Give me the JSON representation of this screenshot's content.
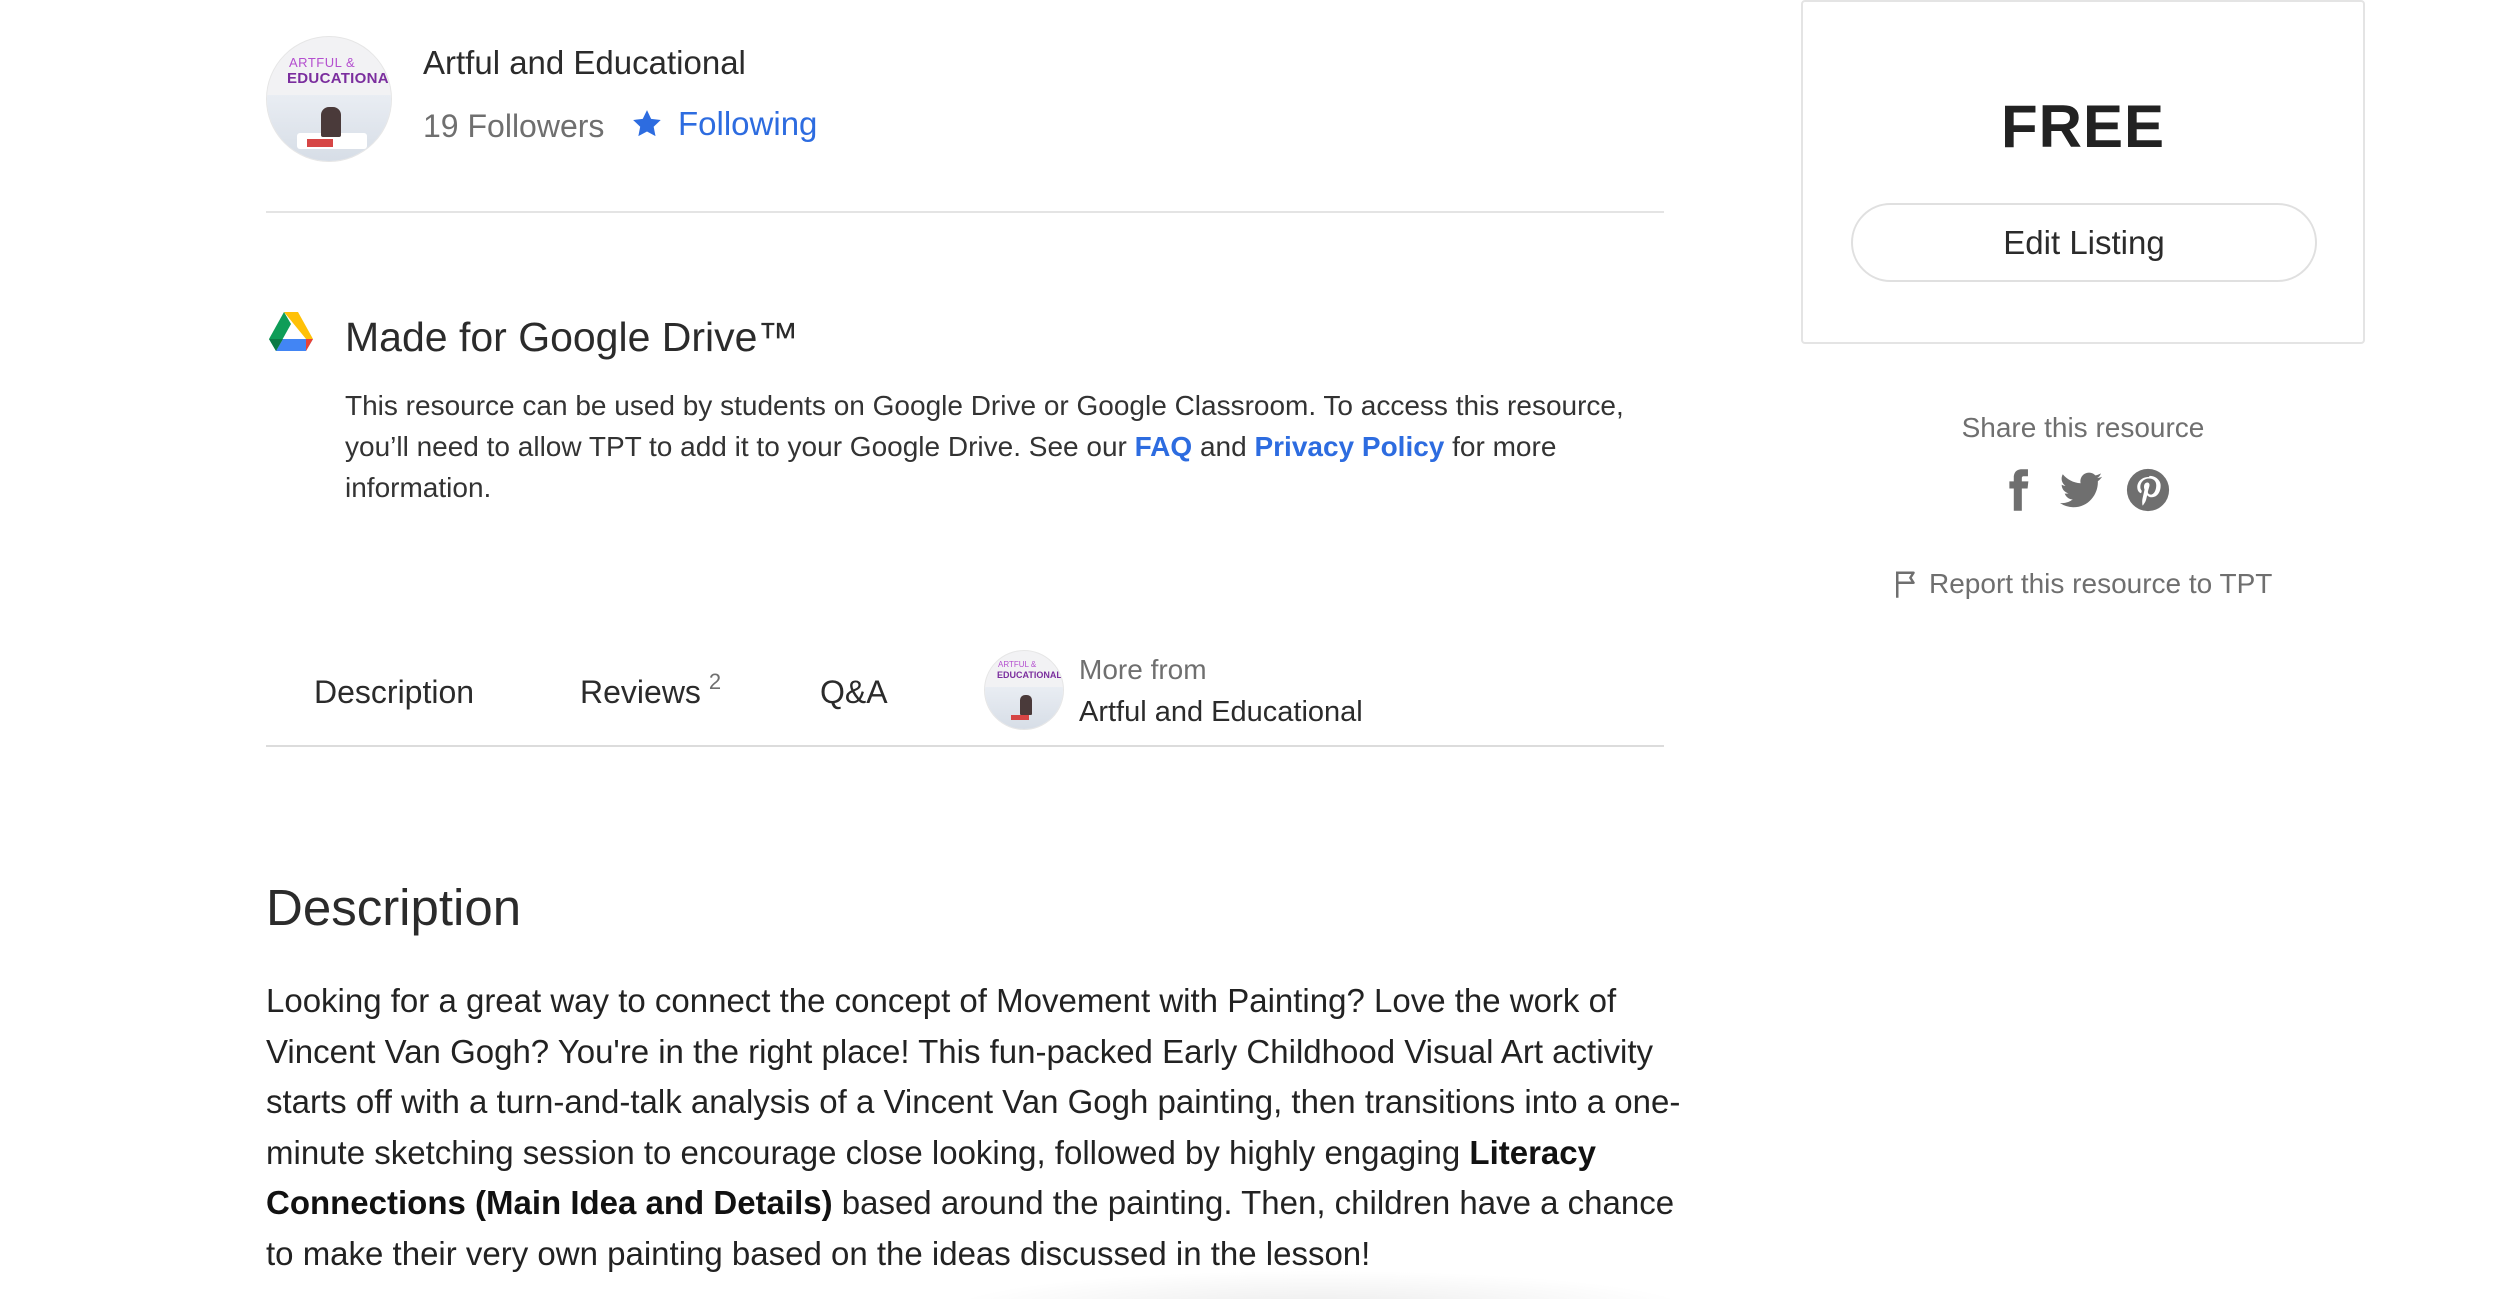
{
  "seller": {
    "name": "Artful and Educational",
    "followers": "19 Followers",
    "follow_label": "Following",
    "avatar_text_line1": "ARTFUL &",
    "avatar_text_line2": "EDUCATIONAL"
  },
  "google_drive": {
    "title": "Made for Google Drive™",
    "text_before": "This resource can be used by students on Google Drive or Google Classroom. To access this resource, you’ll need to allow TPT to add it to your Google Drive. See our ",
    "faq_link": "FAQ",
    "text_and": " and ",
    "privacy_link": "Privacy Policy",
    "text_after": " for more information."
  },
  "tabs": {
    "description": "Description",
    "reviews": "Reviews",
    "reviews_count": "2",
    "qa": "Q&A",
    "more_from_label": "More from",
    "more_from_name": "Artful and Educational"
  },
  "description": {
    "heading": "Description",
    "p1": "Looking for a great way to connect the concept of Movement with Painting? Love the work of Vincent Van Gogh? You're in the right place! This fun-packed Early Childhood Visual Art activity starts off with a turn-and-talk analysis of a Vincent Van Gogh painting, then transitions into a one-minute sketching session to encourage close looking, followed by highly engaging ",
    "p1_bold": "Literacy Connections (Main Idea and Details)",
    "p1_end": " based around the painting. Then, children have a chance to make their very own painting based on the ideas discussed in the lesson!"
  },
  "sidebar": {
    "price": "FREE",
    "edit_button": "Edit Listing",
    "share_label": "Share this resource",
    "report_label": "Report this resource to TPT"
  },
  "colors": {
    "link_blue": "#2d6ce0",
    "muted_text": "#6f6f6f",
    "divider": "#e4e4e4"
  },
  "icons": [
    "star-icon",
    "google-drive-icon",
    "facebook-icon",
    "twitter-icon",
    "pinterest-icon",
    "flag-icon"
  ]
}
